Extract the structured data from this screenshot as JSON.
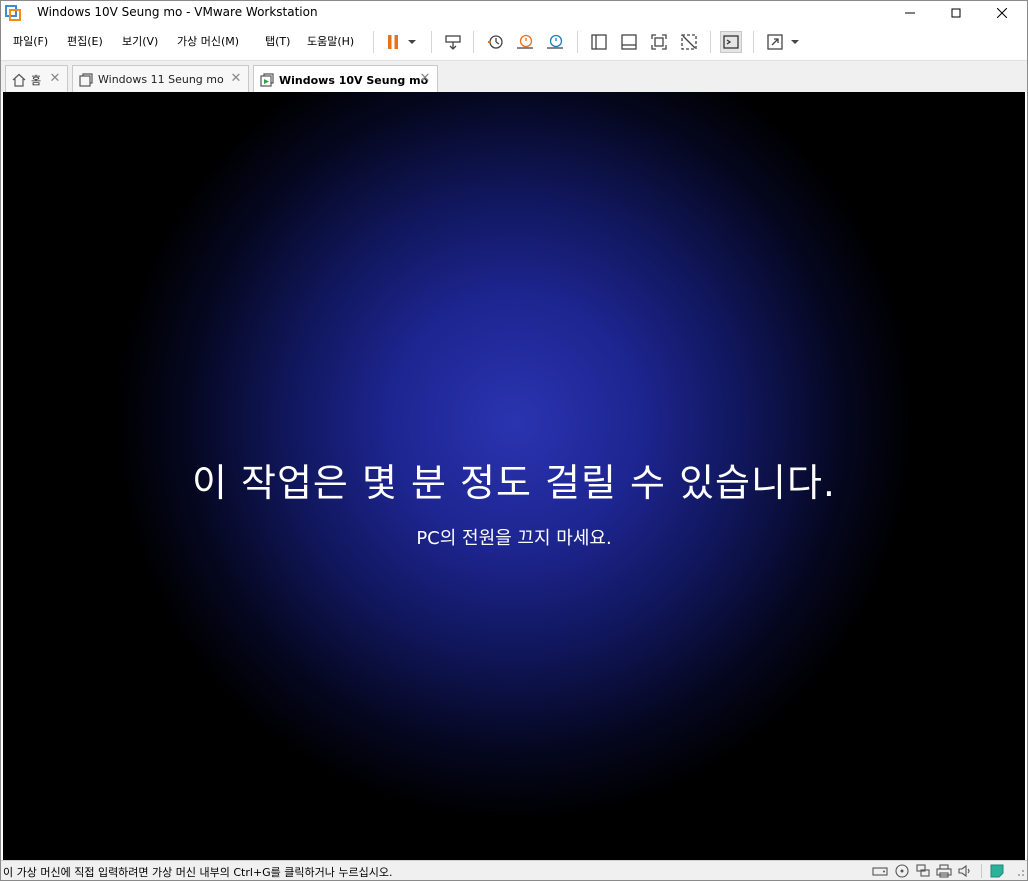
{
  "window": {
    "title": "Windows 10V Seung mo - VMware Workstation"
  },
  "menu": {
    "file": "파일(F)",
    "edit": "편집(E)",
    "view": "보기(V)",
    "vm": "가상 머신(M)",
    "tabs": "탭(T)",
    "help": "도움말(H)"
  },
  "tabs": [
    {
      "label": "홈",
      "icon": "home-icon"
    },
    {
      "label": "Windows 11 Seung mo",
      "icon": "vm-icon"
    },
    {
      "label": "Windows 10V Seung mo",
      "icon": "vm-running-icon",
      "active": true
    }
  ],
  "vm_screen": {
    "heading": "이 작업은 몇 분 정도 걸릴 수 있습니다.",
    "subheading": "PC의 전원을 끄지 마세요."
  },
  "status_bar": {
    "message": "이 가상 머신에 직접 입력하려면 가상 머신 내부의 Ctrl+G를 클릭하거나 누르십시오."
  },
  "colors": {
    "pause_accent": "#e8711a",
    "snapshot_accent": "#e8711a",
    "vm_background": "#1d2590"
  }
}
